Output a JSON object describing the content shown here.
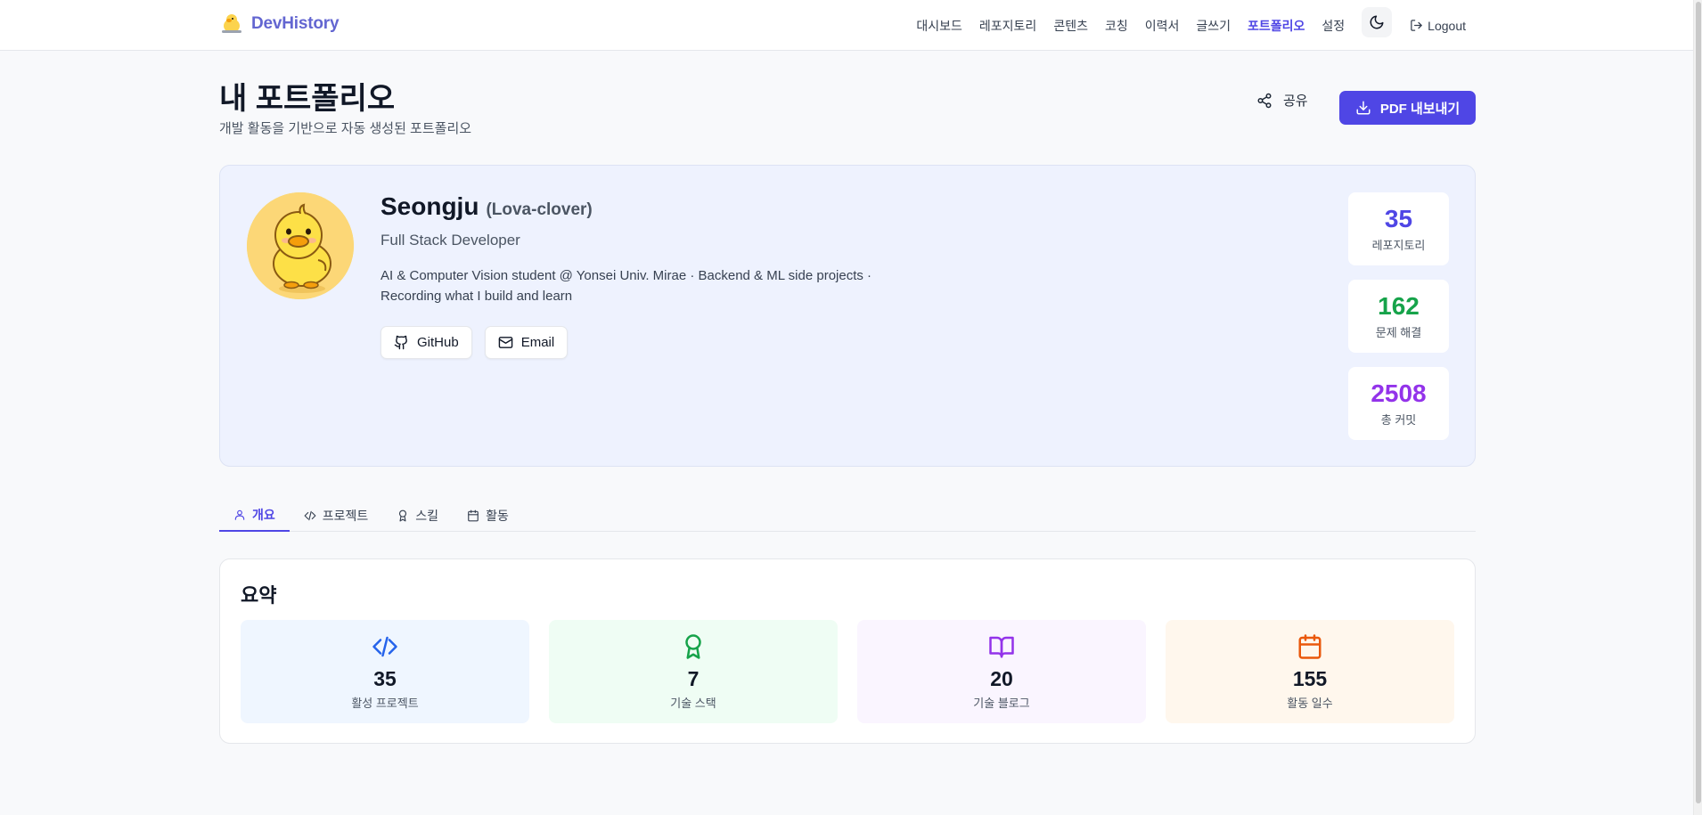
{
  "header": {
    "brand": "DevHistory",
    "nav": [
      "대시보드",
      "레포지토리",
      "콘텐츠",
      "코칭",
      "이력서",
      "글쓰기",
      "포트폴리오",
      "설정"
    ],
    "active_nav": "포트폴리오",
    "logout_label": "Logout"
  },
  "page": {
    "title": "내 포트폴리오",
    "subtitle": "개발 활동을 기반으로 자동 생성된 포트폴리오",
    "share_label": "공유",
    "pdf_label": "PDF 내보내기"
  },
  "profile": {
    "name": "Seongju",
    "login": "(Lova-clover)",
    "role": "Full Stack Developer",
    "bio_line1": "AI & Computer Vision student @ Yonsei Univ. Mirae · Backend & ML side projects ·",
    "bio_line2": "Recording what I build and learn",
    "github_label": "GitHub",
    "email_label": "Email"
  },
  "stats": [
    {
      "value": "35",
      "label": "레포지토리",
      "color": "#4f46e5"
    },
    {
      "value": "162",
      "label": "문제 해결",
      "color": "#16a34a"
    },
    {
      "value": "2508",
      "label": "총 커밋",
      "color": "#9333ea"
    }
  ],
  "tabs": [
    {
      "label": "개요",
      "icon": "user-icon",
      "active": true
    },
    {
      "label": "프로젝트",
      "icon": "code-icon",
      "active": false
    },
    {
      "label": "스킬",
      "icon": "award-icon",
      "active": false
    },
    {
      "label": "활동",
      "icon": "calendar-icon",
      "active": false
    }
  ],
  "summary": {
    "title": "요약",
    "tiles": [
      {
        "value": "35",
        "label": "활성 프로젝트",
        "icon": "code-icon",
        "color": "#2563eb",
        "bg": "#eff6ff"
      },
      {
        "value": "7",
        "label": "기술 스택",
        "icon": "award-icon",
        "color": "#16a34a",
        "bg": "#effdf4"
      },
      {
        "value": "20",
        "label": "기술 블로그",
        "icon": "book-icon",
        "color": "#9333ea",
        "bg": "#faf5ff"
      },
      {
        "value": "155",
        "label": "활동 일수",
        "icon": "calendar-icon",
        "color": "#ea580c",
        "bg": "#fff7ed"
      }
    ]
  }
}
